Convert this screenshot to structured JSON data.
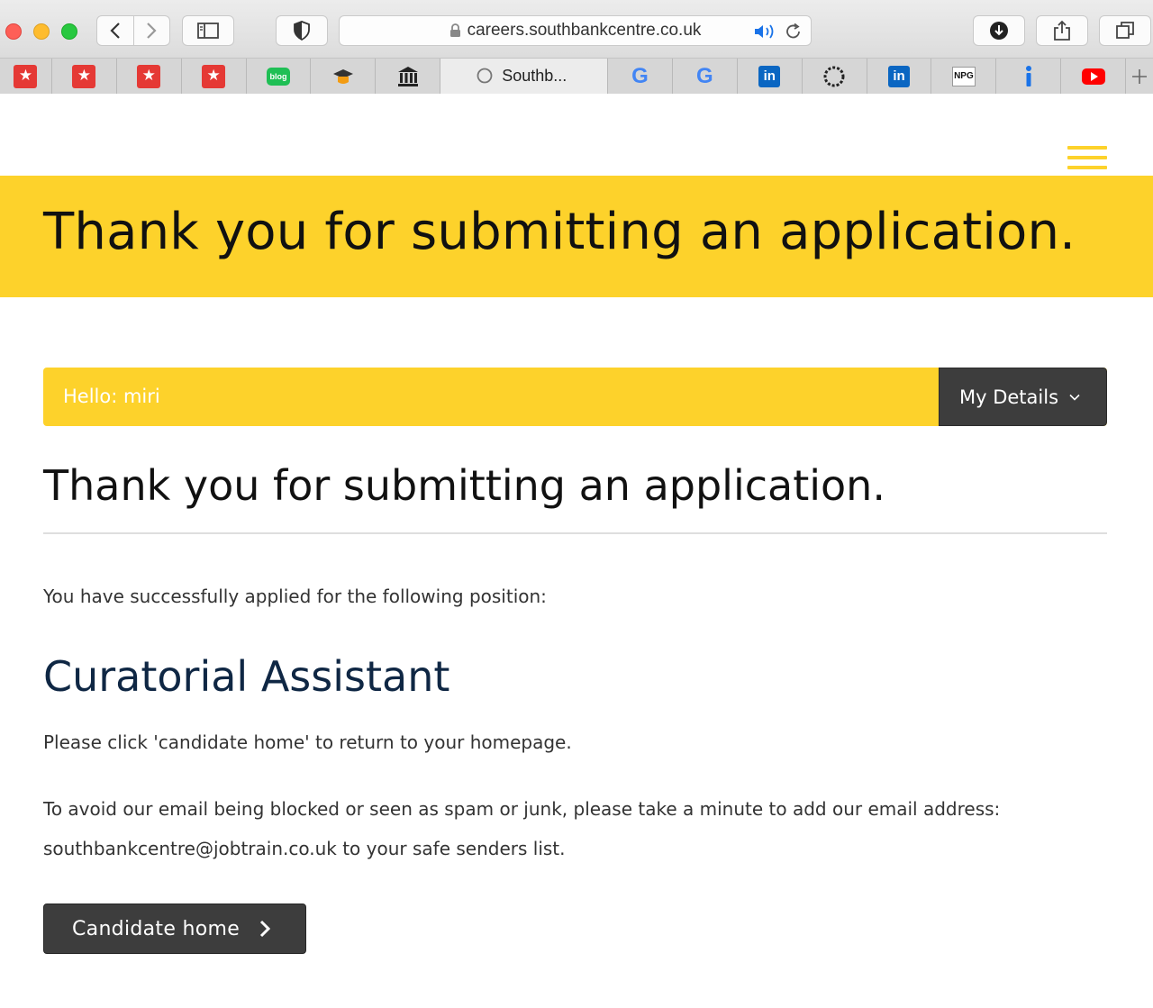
{
  "browser": {
    "url": "careers.southbankcentre.co.uk",
    "active_tab_label": "Southb...",
    "bookmarks": [
      {
        "icon": "star-logo-icon"
      },
      {
        "icon": "star-logo-icon"
      },
      {
        "icon": "star-logo-icon"
      },
      {
        "icon": "star-logo-icon"
      },
      {
        "icon": "blog-icon",
        "text": "blog"
      },
      {
        "icon": "graduation-cap-icon"
      },
      {
        "icon": "museum-icon"
      },
      {
        "icon": "loading-circle-icon",
        "active": true
      },
      {
        "icon": "google-icon",
        "text": "G"
      },
      {
        "icon": "google-icon",
        "text": "G"
      },
      {
        "icon": "linkedin-icon",
        "text": "in"
      },
      {
        "icon": "circle-dots-icon"
      },
      {
        "icon": "linkedin-icon",
        "text": "in"
      },
      {
        "icon": "npg-icon",
        "text": "NPG"
      },
      {
        "icon": "info-icon"
      },
      {
        "icon": "youtube-icon"
      }
    ]
  },
  "page": {
    "hero_title": "Thank you for submitting an application.",
    "greeting": "Hello: miri",
    "my_details_label": "My Details",
    "content_title": "Thank you for submitting an application.",
    "intro_text": "You have successfully applied for the following position:",
    "position_title": "Curatorial Assistant",
    "home_instruction": "Please click 'candidate home' to return to your homepage.",
    "spam_notice": "To avoid our email being blocked or seen as spam or junk, please take a minute to add our email address: southbankcentre@jobtrain.co.uk to your safe senders list.",
    "candidate_home_label": "Candidate home"
  },
  "colors": {
    "brand_yellow": "#fdd22b",
    "dark_button": "#3d3d3d",
    "position_title": "#0f2744"
  }
}
